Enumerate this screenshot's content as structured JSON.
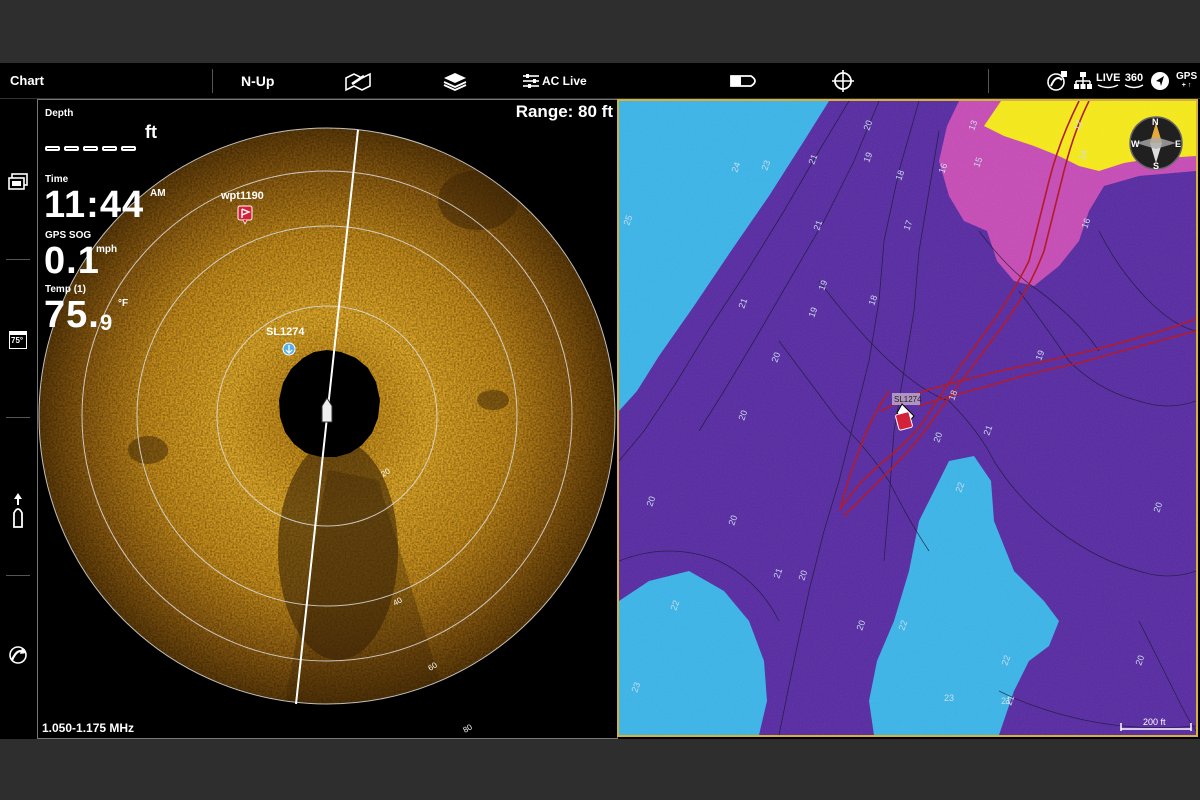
{
  "topbar": {
    "chart_label": "Chart",
    "orientation_label": "N-Up",
    "autochart_label": "AC Live",
    "live_label": "LIVE",
    "deg360_label": "360",
    "gps_label": "GPS"
  },
  "sidebar": {
    "temp_icon_text": "75°"
  },
  "sonar": {
    "range_text": "Range: 80 ft",
    "frequency_text": "1.050-1.175 MHz",
    "depth": {
      "label": "Depth",
      "unit": "ft"
    },
    "time": {
      "label": "Time",
      "value": "11:44",
      "suffix": "AM"
    },
    "sog": {
      "label": "GPS SOG",
      "value": "0.1",
      "unit": "mph"
    },
    "temp": {
      "label": "Temp (1)",
      "value": "75.",
      "decimal": "9",
      "unit": "°F"
    },
    "waypoint_label": "wpt1190",
    "sl_label": "SL1274",
    "ring_labels": [
      "20",
      "40",
      "60",
      "80"
    ]
  },
  "map": {
    "depth_labels": [
      "25",
      "24",
      "23",
      "21",
      "20",
      "19",
      "18",
      "17",
      "16",
      "15",
      "13",
      "14",
      "12",
      "16",
      "21",
      "19",
      "18",
      "20",
      "21",
      "19",
      "20",
      "18",
      "20",
      "21",
      "22",
      "20",
      "20",
      "21",
      "20",
      "22",
      "22",
      "20",
      "21",
      "20",
      "22",
      "23",
      "23",
      "21",
      "20",
      "19"
    ],
    "sl_label": "SL1274",
    "scale_text": "200 ft",
    "compass": {
      "n": "N",
      "s": "S",
      "e": "E",
      "w": "W"
    },
    "colors": {
      "deep": "#5a2fa2",
      "shallow": "#3fb4e6",
      "pink": "#c54fb5",
      "yellow": "#f3e81e",
      "track": "#b21c2a"
    }
  }
}
